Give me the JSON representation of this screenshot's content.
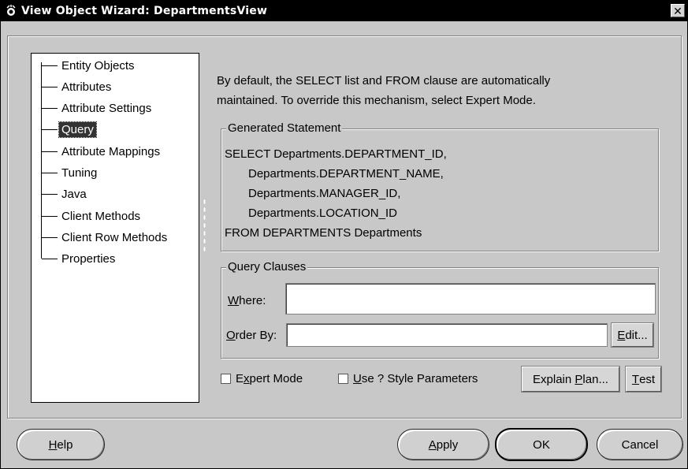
{
  "window": {
    "title": "View Object Wizard: DepartmentsView",
    "close_glyph": "✕"
  },
  "nav": {
    "items": [
      {
        "label": "Entity Objects"
      },
      {
        "label": "Attributes"
      },
      {
        "label": "Attribute Settings"
      },
      {
        "label": "Query",
        "selected": true
      },
      {
        "label": "Attribute Mappings"
      },
      {
        "label": "Tuning"
      },
      {
        "label": "Java"
      },
      {
        "label": "Client Methods"
      },
      {
        "label": "Client Row Methods"
      },
      {
        "label": "Properties"
      }
    ]
  },
  "intro": {
    "line1": "By default, the SELECT list and FROM clause are automatically",
    "line2": "maintained.  To override this mechanism, select Expert Mode."
  },
  "generated": {
    "legend": "Generated Statement",
    "lines": [
      "SELECT Departments.DEPARTMENT_ID,",
      "Departments.DEPARTMENT_NAME,",
      "Departments.MANAGER_ID,",
      "Departments.LOCATION_ID",
      "FROM DEPARTMENTS Departments"
    ]
  },
  "query_clauses": {
    "legend": "Query Clauses",
    "where": {
      "label_mnemonic": "W",
      "label_rest": "here:",
      "value": ""
    },
    "order_by": {
      "label_mnemonic": "O",
      "label_rest": "rder By:",
      "value": ""
    },
    "edit_button": {
      "mnemonic": "E",
      "rest": "dit..."
    }
  },
  "options": {
    "expert_mode": {
      "pre": "E",
      "mnemonic": "x",
      "rest": "pert Mode",
      "checked": false
    },
    "use_style_params": {
      "mnemonic": "U",
      "rest": "se ? Style Parameters",
      "checked": false
    },
    "explain_plan": {
      "pre": "Explain ",
      "mnemonic": "P",
      "rest": "lan..."
    },
    "test": {
      "mnemonic": "T",
      "rest": "est"
    }
  },
  "footer": {
    "help": {
      "mnemonic": "H",
      "rest": "elp"
    },
    "apply": {
      "mnemonic": "A",
      "rest": "pply"
    },
    "ok": "OK",
    "cancel": "Cancel"
  },
  "colors": {
    "dialog_bg": "#c8c8c8",
    "titlebar_bg": "#000000",
    "selection_bg": "#333333"
  },
  "icons": {
    "app": "wizard-app-icon",
    "close": "close-icon"
  }
}
